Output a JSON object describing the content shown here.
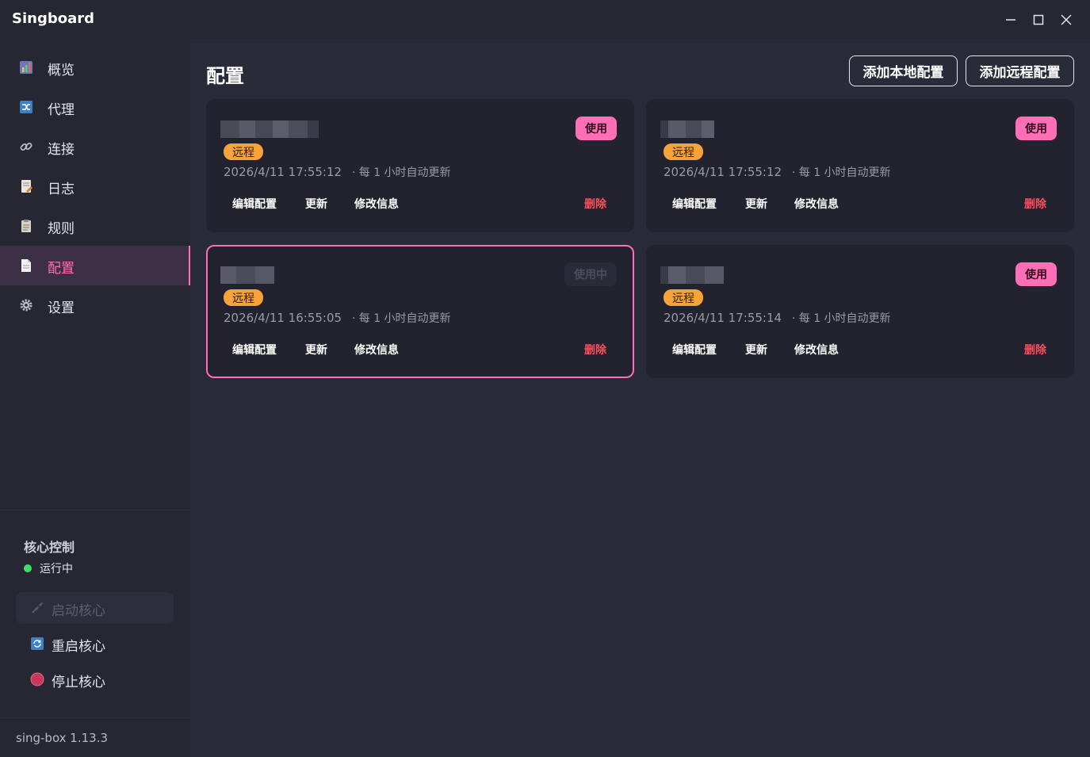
{
  "app": {
    "title": "Singboard"
  },
  "window": {
    "minimize_glyph": "—",
    "maximize_glyph": "☐",
    "close_glyph": "✕"
  },
  "sidebar": {
    "items": [
      {
        "label": "概览",
        "icon": "chart-icon",
        "active": false
      },
      {
        "label": "代理",
        "icon": "shuffle-icon",
        "active": false
      },
      {
        "label": "连接",
        "icon": "link-icon",
        "active": false
      },
      {
        "label": "日志",
        "icon": "log-icon",
        "active": false
      },
      {
        "label": "规则",
        "icon": "rules-icon",
        "active": false
      },
      {
        "label": "配置",
        "icon": "document-icon",
        "active": true
      },
      {
        "label": "设置",
        "icon": "gear-icon",
        "active": false
      }
    ],
    "core": {
      "title": "核心控制",
      "status": "运行中",
      "start_label": "启动核心",
      "restart_label": "重启核心",
      "stop_label": "停止核心"
    },
    "version": "sing-box 1.13.3"
  },
  "main": {
    "title": "配置",
    "add_local_label": "添加本地配置",
    "add_remote_label": "添加远程配置",
    "profiles": [
      {
        "type_label": "远程",
        "timestamp": "2026/4/11 17:55:12",
        "auto_update": "· 每 1 小时自动更新",
        "use_label": "使用",
        "in_use": false,
        "actions": {
          "edit": "编辑配置",
          "update": "更新",
          "modify": "修改信息",
          "delete": "删除"
        }
      },
      {
        "type_label": "远程",
        "timestamp": "2026/4/11 17:55:12",
        "auto_update": "· 每 1 小时自动更新",
        "use_label": "使用",
        "in_use": false,
        "actions": {
          "edit": "编辑配置",
          "update": "更新",
          "modify": "修改信息",
          "delete": "删除"
        }
      },
      {
        "type_label": "远程",
        "timestamp": "2026/4/11 16:55:05",
        "auto_update": "· 每 1 小时自动更新",
        "use_label": "使用中",
        "in_use": true,
        "actions": {
          "edit": "编辑配置",
          "update": "更新",
          "modify": "修改信息",
          "delete": "删除"
        }
      },
      {
        "type_label": "远程",
        "timestamp": "2026/4/11 17:55:14",
        "auto_update": "· 每 1 小时自动更新",
        "use_label": "使用",
        "in_use": false,
        "actions": {
          "edit": "编辑配置",
          "update": "更新",
          "modify": "修改信息",
          "delete": "删除"
        }
      }
    ]
  },
  "colors": {
    "accent": "#ff6fb5",
    "remote_badge": "#f7a23a",
    "danger": "#ff4d5b",
    "status_running": "#3ee06a"
  }
}
